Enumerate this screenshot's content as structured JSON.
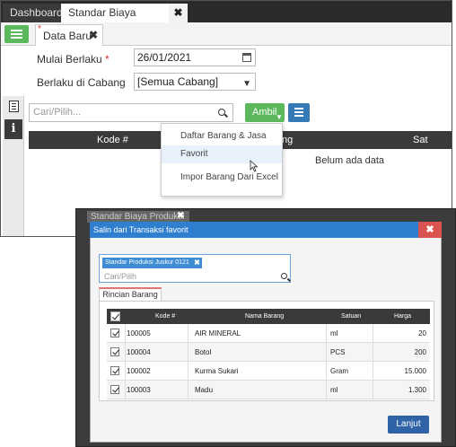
{
  "back": {
    "tabs": {
      "dashboard": "Dashboard",
      "active": "Standar Biaya Produksi",
      "close": "✖"
    },
    "subtab": {
      "label": "Data Baru",
      "close": "✖",
      "star": "*"
    },
    "form": {
      "mulai_label": "Mulai Berlaku",
      "required_mark": "*",
      "mulai_value": "26/01/2021",
      "cabang_label": "Berlaku di Cabang",
      "cabang_value": "[Semua Cabang]"
    },
    "search": {
      "placeholder": "Cari/Pilih..."
    },
    "ambil_label": "Ambil",
    "table": {
      "col_kode": "Kode #",
      "col_nama_partial": "ng",
      "col_satuan_partial": "Sat",
      "empty": "Belum ada data"
    },
    "dropdown": [
      "Daftar Barang & Jasa",
      "Favorit",
      "Impor Barang Dari Excel"
    ]
  },
  "front": {
    "background_strip": {
      "title": "Standar Biaya Produksi",
      "close": "✖"
    },
    "modal": {
      "title": "Salin dari Transaksi favorit",
      "close": "✖",
      "tag": "Standar Produksi Juskur 0121",
      "tag_close": "✖",
      "search_placeholder": "Cari/Pilih",
      "tab": "Rincian Barang",
      "columns": {
        "kode": "Kode #",
        "nama": "Nama Barang",
        "satuan": "Satuan",
        "harga": "Harga"
      },
      "rows": [
        {
          "kode": "100005",
          "nama": "AIR MINERAL",
          "satuan": "ml",
          "harga": "20"
        },
        {
          "kode": "100004",
          "nama": "Botol",
          "satuan": "PCS",
          "harga": "200"
        },
        {
          "kode": "100002",
          "nama": "Kurma Sukari",
          "satuan": "Gram",
          "harga": "15.000"
        },
        {
          "kode": "100003",
          "nama": "Madu",
          "satuan": "ml",
          "harga": "1.300"
        }
      ],
      "lanjut_label": "Lanjut"
    }
  },
  "colors": {
    "green": "#5cb85c",
    "blue_button": "#337ab7",
    "modal_header": "#2f7fd0",
    "close_red": "#d9534f",
    "dark_header": "#3a3a3a",
    "lanjut": "#2f62a7"
  }
}
